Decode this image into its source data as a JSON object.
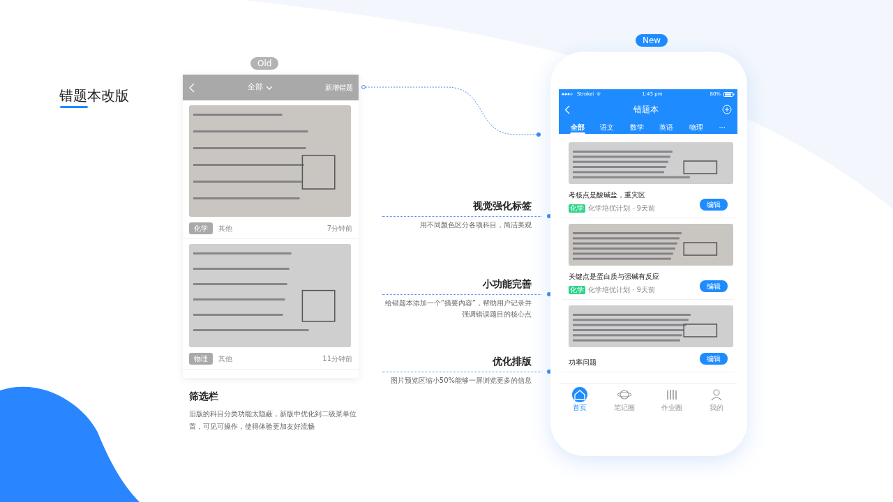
{
  "slide_title": "错题本改版",
  "old": {
    "badge": "Old",
    "filter": "全部",
    "add": "新增错题",
    "cards": [
      {
        "tag": "化学",
        "category": "其他",
        "time": "7分钟前"
      },
      {
        "tag": "物理",
        "category": "其他",
        "time": "11分钟前"
      }
    ],
    "note_title": "筛选栏",
    "note": "旧版的科目分类功能太隐蔽，新版中优化到二级菜单位置，可见可操作，使得体验更加友好流畅"
  },
  "features": [
    {
      "title": "视觉强化标签",
      "desc": "用不同颜色区分各项科目，简洁美观"
    },
    {
      "title": "小功能完善",
      "desc": "给错题本添加一个“摘要内容”，帮助用户记录并强调错误题目的核心点"
    },
    {
      "title": "优化排版",
      "desc": "图片预览区缩小50%能够一屏浏览更多的信息"
    }
  ],
  "new": {
    "badge": "New",
    "status": {
      "carrier": "Strokei",
      "time": "1:43 pm",
      "battery": "80%"
    },
    "title": "错题本",
    "tabs": [
      {
        "label": "全部",
        "selected": true
      },
      {
        "label": "语文",
        "selected": false
      },
      {
        "label": "数学",
        "selected": false
      },
      {
        "label": "英语",
        "selected": false
      },
      {
        "label": "物理",
        "selected": false
      },
      {
        "label": "···",
        "selected": false
      }
    ],
    "cards": [
      {
        "title": "考核点是酸碱盐，重灾区",
        "tag": "化学",
        "color": "#2fd38a",
        "source": "化学培优计划 · 9天前",
        "button": "编辑"
      },
      {
        "title": "关键点是蛋白质与强碱有反应",
        "tag": "化学",
        "color": "#2fd38a",
        "source": "化学培优计划 · 9天前",
        "button": "编辑"
      },
      {
        "title": "功率问题",
        "button": "编辑"
      }
    ],
    "nav": [
      {
        "label": "首页",
        "selected": true
      },
      {
        "label": "笔记圈",
        "selected": false
      },
      {
        "label": "作业圈",
        "selected": false
      },
      {
        "label": "我的",
        "selected": false
      }
    ]
  }
}
